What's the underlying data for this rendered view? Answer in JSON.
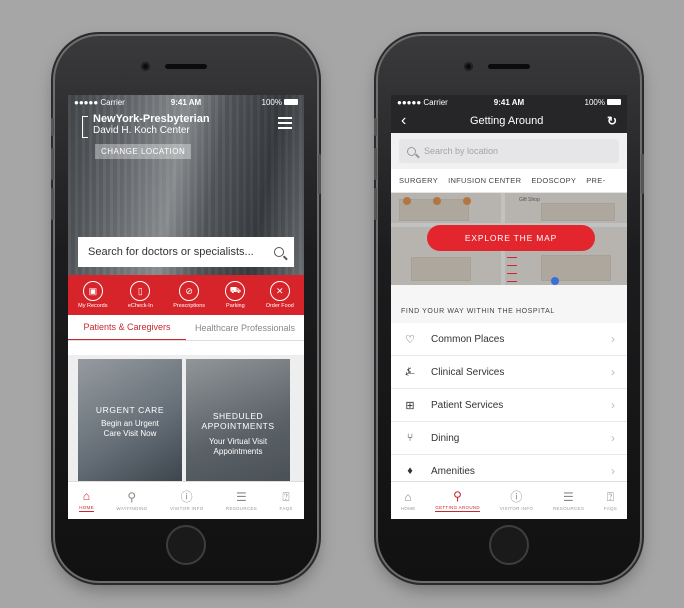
{
  "status": {
    "carrier": "●●●●● Carrier",
    "time": "9:41 AM",
    "battery": "100%"
  },
  "screen1": {
    "brand_name": "NewYork-Presbyterian",
    "brand_sub": "David H. Koch Center",
    "change_location": "CHANGE LOCATION",
    "search_placeholder": "Search for doctors or specialists...",
    "quick_actions": [
      {
        "label": "My Records",
        "icon": "records-icon"
      },
      {
        "label": "eCheck-In",
        "icon": "phone-checkin-icon"
      },
      {
        "label": "Prescriptions",
        "icon": "pill-icon"
      },
      {
        "label": "Parking",
        "icon": "car-icon"
      },
      {
        "label": "Order Food",
        "icon": "utensils-icon"
      }
    ],
    "tabs": [
      "Patients & Caregivers",
      "Healthcare Professionals"
    ],
    "cards": {
      "urgent_title": "URGENT CARE",
      "urgent_line1": "Begin an Urgent",
      "urgent_line2": "Care Visit Now",
      "sched_title1": "SHEDULED",
      "sched_title2": "APPOINTMENTS",
      "sched_line1": "Your Virtual Visit",
      "sched_line2": "Appointments"
    }
  },
  "screen2": {
    "title": "Getting Around",
    "search_placeholder": "Search by location",
    "categories": [
      "SURGERY",
      "INFUSION CENTER",
      "EDOSCOPY",
      "PRE-"
    ],
    "map_label": "Gift Shop",
    "explore_label": "EXPLORE THE MAP",
    "section_title": "FIND YOUR WAY WITHIN THE HOSPITAL",
    "list": [
      {
        "label": "Common Places",
        "icon": "heart-icon"
      },
      {
        "label": "Clinical Services",
        "icon": "pulse-icon"
      },
      {
        "label": "Patient Services",
        "icon": "medical-case-icon"
      },
      {
        "label": "Dining",
        "icon": "dining-icon"
      },
      {
        "label": "Amenities",
        "icon": "amenities-icon"
      }
    ]
  },
  "tabbar1": [
    "HOME",
    "WAYFINDING",
    "VISITOR INFO",
    "RESOURCES",
    "FAQS"
  ],
  "tabbar2": [
    "HOME",
    "GETTING AROUND",
    "VISITOR INFO",
    "RESOURCES",
    "FAQS"
  ],
  "colors": {
    "brand_red": "#d6242a",
    "dark_header": "#262628"
  }
}
